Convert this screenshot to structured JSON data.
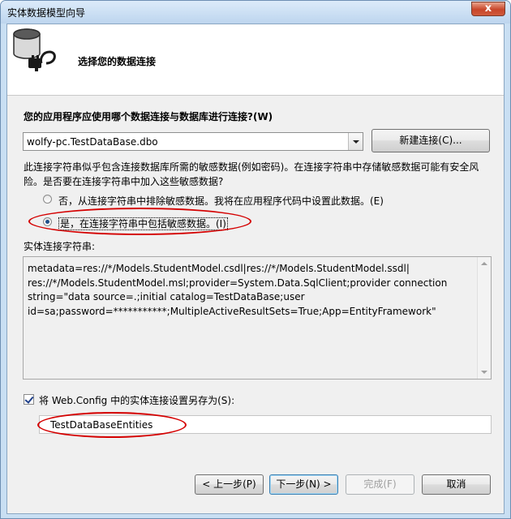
{
  "window": {
    "title": "实体数据模型向导",
    "close_label": "x"
  },
  "header": {
    "icon": "database-plug-icon",
    "title": "选择您的数据连接"
  },
  "question": "您的应用程序应使用哪个数据连接与数据库进行连接?(W)",
  "connection": {
    "selected": "wolfy-pc.TestDataBase.dbo",
    "new_button": "新建连接(C)..."
  },
  "sensitive_info": "此连接字符串似乎包含连接数据库所需的敏感数据(例如密码)。在连接字符串中存储敏感数据可能有安全风险。是否要在连接字符串中加入这些敏感数据?",
  "radio_exclude": {
    "label": "否，从连接字符串中排除敏感数据。我将在应用程序代码中设置此数据。(E)",
    "checked": false
  },
  "radio_include": {
    "label": "是，在连接字符串中包括敏感数据。(I)",
    "checked": true
  },
  "connection_string": {
    "label": "实体连接字符串:",
    "value": "metadata=res://*/Models.StudentModel.csdl|res://*/Models.StudentModel.ssdl|\nres://*/Models.StudentModel.msl;provider=System.Data.SqlClient;provider connection\nstring=\"data source=.;initial catalog=TestDataBase;user\nid=sa;password=***********;MultipleActiveResultSets=True;App=EntityFramework\""
  },
  "save_config": {
    "label": "将 Web.Config 中的实体连接设置另存为(S):",
    "checked": true,
    "value": "TestDataBaseEntities"
  },
  "buttons": {
    "back": "< 上一步(P)",
    "next": "下一步(N) >",
    "finish": "完成(F)",
    "cancel": "取消"
  },
  "colors": {
    "highlight_ellipse": "#d40000",
    "window_frame": "#c9dff3"
  }
}
